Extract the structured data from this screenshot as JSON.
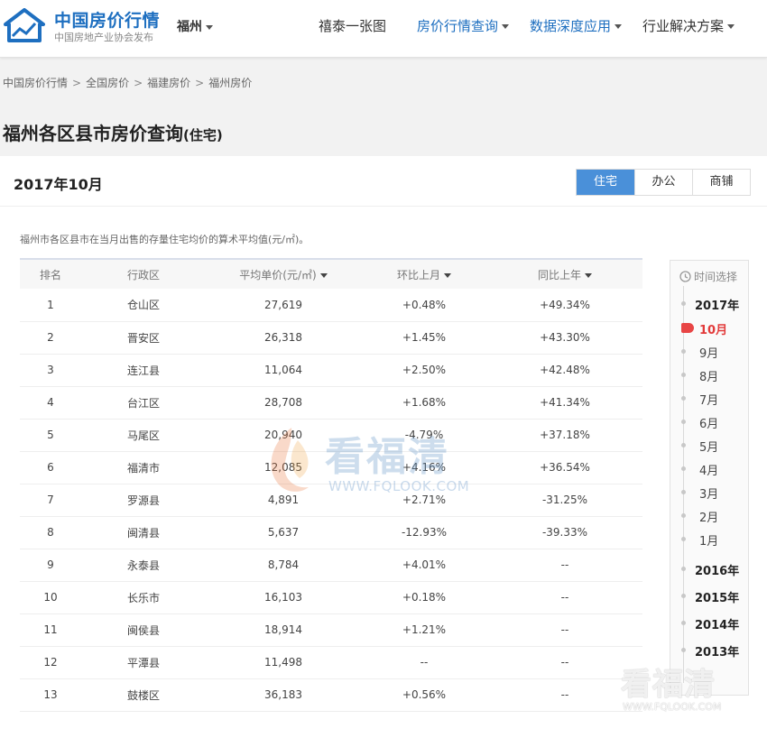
{
  "header": {
    "logo_title": "中国房价行情",
    "logo_subtitle": "中国房地产业协会发布",
    "city": "福州",
    "nav": [
      {
        "label": "禧泰一张图"
      },
      {
        "label": "房价行情查询"
      },
      {
        "label": "数据深度应用"
      },
      {
        "label": "行业解决方案"
      }
    ]
  },
  "breadcrumb": [
    "中国房价行情",
    "全国房价",
    "福建房价",
    "福州房价"
  ],
  "breadcrumb_sep": ">",
  "page_title": "福州各区县市房价查询",
  "page_title_suffix": "(住宅)",
  "period": "2017年10月",
  "type_tabs": [
    "住宅",
    "办公",
    "商铺"
  ],
  "active_type": "住宅",
  "description": "福州市各区县市在当月出售的存量住宅均价的算术平均值(元/㎡)。",
  "table": {
    "headers": [
      "排名",
      "行政区",
      "平均单价(元/㎡)",
      "环比上月",
      "同比上年"
    ],
    "rows": [
      {
        "rank": "1",
        "district": "仓山区",
        "price": "27,619",
        "mom": "+0.48%",
        "yoy": "+49.34%"
      },
      {
        "rank": "2",
        "district": "晋安区",
        "price": "26,318",
        "mom": "+1.45%",
        "yoy": "+43.30%"
      },
      {
        "rank": "3",
        "district": "连江县",
        "price": "11,064",
        "mom": "+2.50%",
        "yoy": "+42.48%"
      },
      {
        "rank": "4",
        "district": "台江区",
        "price": "28,708",
        "mom": "+1.68%",
        "yoy": "+41.34%"
      },
      {
        "rank": "5",
        "district": "马尾区",
        "price": "20,940",
        "mom": "-4.79%",
        "yoy": "+37.18%"
      },
      {
        "rank": "6",
        "district": "福清市",
        "price": "12,085",
        "mom": "+4.16%",
        "yoy": "+36.54%"
      },
      {
        "rank": "7",
        "district": "罗源县",
        "price": "4,891",
        "mom": "+2.71%",
        "yoy": "-31.25%"
      },
      {
        "rank": "8",
        "district": "闽清县",
        "price": "5,637",
        "mom": "-12.93%",
        "yoy": "-39.33%"
      },
      {
        "rank": "9",
        "district": "永泰县",
        "price": "8,784",
        "mom": "+4.01%",
        "yoy": "--"
      },
      {
        "rank": "10",
        "district": "长乐市",
        "price": "16,103",
        "mom": "+0.18%",
        "yoy": "--"
      },
      {
        "rank": "11",
        "district": "闽侯县",
        "price": "18,914",
        "mom": "+1.21%",
        "yoy": "--"
      },
      {
        "rank": "12",
        "district": "平潭县",
        "price": "11,498",
        "mom": "--",
        "yoy": "--"
      },
      {
        "rank": "13",
        "district": "鼓楼区",
        "price": "36,183",
        "mom": "+0.56%",
        "yoy": "--"
      }
    ]
  },
  "timeline": {
    "heading": "时间选择",
    "current_year": "2017年",
    "months": [
      "10月",
      "9月",
      "8月",
      "7月",
      "6月",
      "5月",
      "4月",
      "3月",
      "2月",
      "1月"
    ],
    "active_month": "10月",
    "past_years": [
      "2016年",
      "2015年",
      "2014年",
      "2013年"
    ]
  },
  "watermark": {
    "text": "看福清",
    "url": "WWW.FQLOOK.COM"
  },
  "colors": {
    "brand_blue": "#1e6fc0",
    "tab_active": "#4a90d9",
    "increase": "#e23a3a",
    "decrease": "#3e9a2a"
  }
}
